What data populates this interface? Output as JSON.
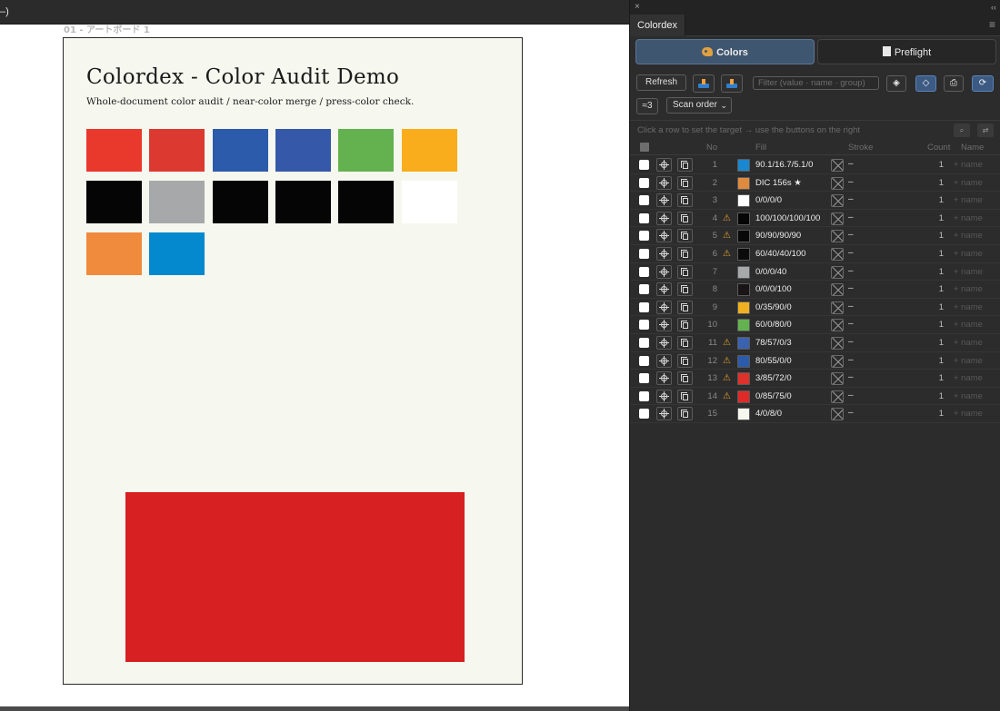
{
  "document": {
    "tab_fragment": "–)",
    "artboard_name": "01 - アートボード 1",
    "title": "Colordex - Color Audit Demo",
    "subtitle": "Whole-document color audit / near-color merge / press-color check.",
    "swatch_colors": [
      "#e9382c",
      "#dc3a31",
      "#2d5bab",
      "#3658a8",
      "#63b24f",
      "#f9ad1d",
      "#050505",
      "#a7a8a9",
      "#050505",
      "#050505",
      "#050505",
      "#ffffff",
      "#f08a3c",
      "#0489cf"
    ],
    "big_rect_color": "#d72021"
  },
  "panel": {
    "close_glyph": "×",
    "collapse_glyph": "‹‹",
    "tab_title": "Colordex",
    "menu_glyph": "≡",
    "tabs": {
      "colors": "Colors",
      "preflight": "Preflight"
    },
    "toolbar": {
      "refresh": "Refresh",
      "filter_placeholder": "Filter (value · name · group)",
      "layers_glyph": "◈",
      "tag_glyph": "◇",
      "print_glyph": "⎙",
      "sync_glyph": "⟳",
      "approx": "≈3",
      "sort_value": "Scan order",
      "sort_chevron": "⌄"
    },
    "hint": "Click a row to set the target → use the buttons on the right",
    "search_glyph": "⌕",
    "swap_glyph": "⇄",
    "columns": {
      "no": "No",
      "fill": "Fill",
      "stroke": "Stroke",
      "count": "Count",
      "name": "Name"
    },
    "rows": [
      {
        "no": "1",
        "warn": "",
        "swatch": "#1a88d0",
        "fill": "90.1/16.7/5.1/0",
        "stroke": "–",
        "count": "1",
        "name": "+ name"
      },
      {
        "no": "2",
        "warn": "",
        "swatch": "#e08a40",
        "fill": "DIC 156s ★",
        "stroke": "–",
        "count": "1",
        "name": "+ name"
      },
      {
        "no": "3",
        "warn": "",
        "swatch": "#ffffff",
        "fill": "0/0/0/0",
        "stroke": "–",
        "count": "1",
        "name": "+ name"
      },
      {
        "no": "4",
        "warn": "⚠",
        "swatch": "#050505",
        "fill": "100/100/100/100",
        "stroke": "–",
        "count": "1",
        "name": "+ name"
      },
      {
        "no": "5",
        "warn": "⚠",
        "swatch": "#080808",
        "fill": "90/90/90/90",
        "stroke": "–",
        "count": "1",
        "name": "+ name"
      },
      {
        "no": "6",
        "warn": "⚠",
        "swatch": "#0b0b0b",
        "fill": "60/40/40/100",
        "stroke": "–",
        "count": "1",
        "name": "+ name"
      },
      {
        "no": "7",
        "warn": "",
        "swatch": "#a7a8a9",
        "fill": "0/0/0/40",
        "stroke": "–",
        "count": "1",
        "name": "+ name"
      },
      {
        "no": "8",
        "warn": "",
        "swatch": "#1a1416",
        "fill": "0/0/0/100",
        "stroke": "–",
        "count": "1",
        "name": "+ name"
      },
      {
        "no": "9",
        "warn": "",
        "swatch": "#f0b020",
        "fill": "0/35/90/0",
        "stroke": "–",
        "count": "1",
        "name": "+ name"
      },
      {
        "no": "10",
        "warn": "",
        "swatch": "#63b24f",
        "fill": "60/0/80/0",
        "stroke": "–",
        "count": "1",
        "name": "+ name"
      },
      {
        "no": "11",
        "warn": "⚠",
        "swatch": "#3a62b0",
        "fill": "78/57/0/3",
        "stroke": "–",
        "count": "1",
        "name": "+ name"
      },
      {
        "no": "12",
        "warn": "⚠",
        "swatch": "#2d5bab",
        "fill": "80/55/0/0",
        "stroke": "–",
        "count": "1",
        "name": "+ name"
      },
      {
        "no": "13",
        "warn": "⚠",
        "swatch": "#e0302a",
        "fill": "3/85/72/0",
        "stroke": "–",
        "count": "1",
        "name": "+ name"
      },
      {
        "no": "14",
        "warn": "⚠",
        "swatch": "#e02a28",
        "fill": "0/85/75/0",
        "stroke": "–",
        "count": "1",
        "name": "+ name"
      },
      {
        "no": "15",
        "warn": "",
        "swatch": "#f6f8ef",
        "fill": "4/0/8/0",
        "stroke": "–",
        "count": "1",
        "name": "+ name"
      }
    ]
  }
}
